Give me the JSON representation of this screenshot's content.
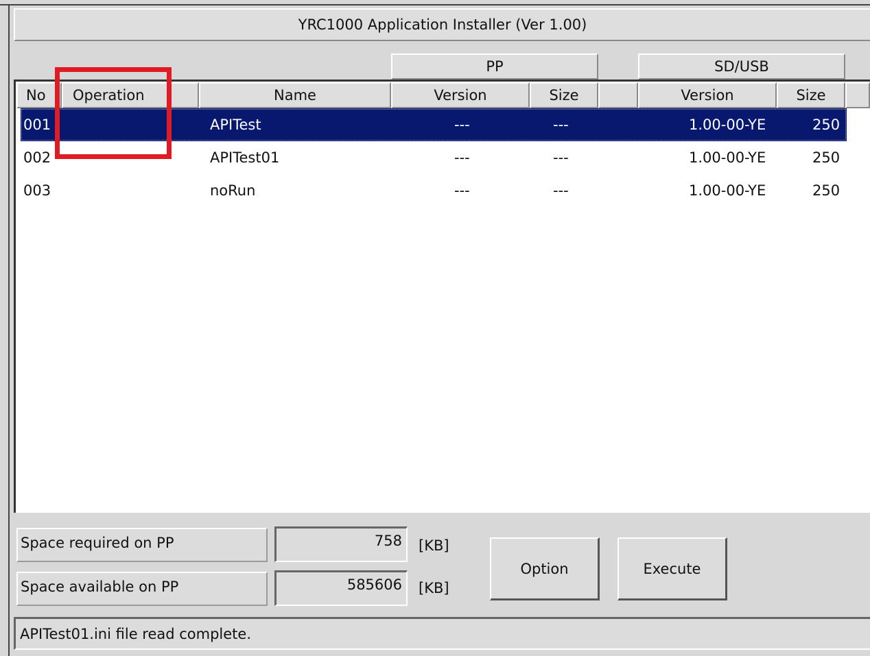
{
  "window": {
    "title": "YRC1000 Application Installer  (Ver 1.00)"
  },
  "groups": {
    "pp": "PP",
    "sd_usb": "SD/USB"
  },
  "columns": {
    "no": "No",
    "operation": "Operation",
    "name": "Name",
    "pp_version": "Version",
    "pp_size": "Size",
    "sd_version": "Version",
    "sd_size": "Size"
  },
  "rows": [
    {
      "no": "001",
      "operation": "",
      "name": "APITest",
      "pp_version": "---",
      "pp_size": "---",
      "sd_version": "1.00-00-YE",
      "sd_size": "250",
      "selected": true
    },
    {
      "no": "002",
      "operation": "",
      "name": "APITest01",
      "pp_version": "---",
      "pp_size": "---",
      "sd_version": "1.00-00-YE",
      "sd_size": "250",
      "selected": false
    },
    {
      "no": "003",
      "operation": "",
      "name": "noRun",
      "pp_version": "---",
      "pp_size": "---",
      "sd_version": "1.00-00-YE",
      "sd_size": "250",
      "selected": false
    }
  ],
  "space": {
    "required_label": "Space required on PP",
    "required_value": "758",
    "available_label": "Space available on PP",
    "available_value": "585606",
    "unit": "[KB]"
  },
  "buttons": {
    "option": "Option",
    "execute": "Execute"
  },
  "status": {
    "message": "APITest01.ini file read complete."
  },
  "colors": {
    "selection": "#08186f",
    "highlight_box": "#e01b24",
    "window_bg": "#d8d8d8"
  }
}
